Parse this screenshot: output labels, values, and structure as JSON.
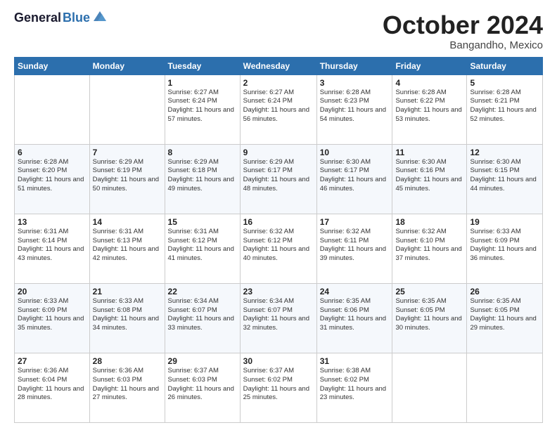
{
  "header": {
    "logo_general": "General",
    "logo_blue": "Blue",
    "month": "October 2024",
    "location": "Bangandho, Mexico"
  },
  "weekdays": [
    "Sunday",
    "Monday",
    "Tuesday",
    "Wednesday",
    "Thursday",
    "Friday",
    "Saturday"
  ],
  "weeks": [
    [
      {
        "day": "",
        "info": ""
      },
      {
        "day": "",
        "info": ""
      },
      {
        "day": "1",
        "info": "Sunrise: 6:27 AM\nSunset: 6:24 PM\nDaylight: 11 hours and 57 minutes."
      },
      {
        "day": "2",
        "info": "Sunrise: 6:27 AM\nSunset: 6:24 PM\nDaylight: 11 hours and 56 minutes."
      },
      {
        "day": "3",
        "info": "Sunrise: 6:28 AM\nSunset: 6:23 PM\nDaylight: 11 hours and 54 minutes."
      },
      {
        "day": "4",
        "info": "Sunrise: 6:28 AM\nSunset: 6:22 PM\nDaylight: 11 hours and 53 minutes."
      },
      {
        "day": "5",
        "info": "Sunrise: 6:28 AM\nSunset: 6:21 PM\nDaylight: 11 hours and 52 minutes."
      }
    ],
    [
      {
        "day": "6",
        "info": "Sunrise: 6:28 AM\nSunset: 6:20 PM\nDaylight: 11 hours and 51 minutes."
      },
      {
        "day": "7",
        "info": "Sunrise: 6:29 AM\nSunset: 6:19 PM\nDaylight: 11 hours and 50 minutes."
      },
      {
        "day": "8",
        "info": "Sunrise: 6:29 AM\nSunset: 6:18 PM\nDaylight: 11 hours and 49 minutes."
      },
      {
        "day": "9",
        "info": "Sunrise: 6:29 AM\nSunset: 6:17 PM\nDaylight: 11 hours and 48 minutes."
      },
      {
        "day": "10",
        "info": "Sunrise: 6:30 AM\nSunset: 6:17 PM\nDaylight: 11 hours and 46 minutes."
      },
      {
        "day": "11",
        "info": "Sunrise: 6:30 AM\nSunset: 6:16 PM\nDaylight: 11 hours and 45 minutes."
      },
      {
        "day": "12",
        "info": "Sunrise: 6:30 AM\nSunset: 6:15 PM\nDaylight: 11 hours and 44 minutes."
      }
    ],
    [
      {
        "day": "13",
        "info": "Sunrise: 6:31 AM\nSunset: 6:14 PM\nDaylight: 11 hours and 43 minutes."
      },
      {
        "day": "14",
        "info": "Sunrise: 6:31 AM\nSunset: 6:13 PM\nDaylight: 11 hours and 42 minutes."
      },
      {
        "day": "15",
        "info": "Sunrise: 6:31 AM\nSunset: 6:12 PM\nDaylight: 11 hours and 41 minutes."
      },
      {
        "day": "16",
        "info": "Sunrise: 6:32 AM\nSunset: 6:12 PM\nDaylight: 11 hours and 40 minutes."
      },
      {
        "day": "17",
        "info": "Sunrise: 6:32 AM\nSunset: 6:11 PM\nDaylight: 11 hours and 39 minutes."
      },
      {
        "day": "18",
        "info": "Sunrise: 6:32 AM\nSunset: 6:10 PM\nDaylight: 11 hours and 37 minutes."
      },
      {
        "day": "19",
        "info": "Sunrise: 6:33 AM\nSunset: 6:09 PM\nDaylight: 11 hours and 36 minutes."
      }
    ],
    [
      {
        "day": "20",
        "info": "Sunrise: 6:33 AM\nSunset: 6:09 PM\nDaylight: 11 hours and 35 minutes."
      },
      {
        "day": "21",
        "info": "Sunrise: 6:33 AM\nSunset: 6:08 PM\nDaylight: 11 hours and 34 minutes."
      },
      {
        "day": "22",
        "info": "Sunrise: 6:34 AM\nSunset: 6:07 PM\nDaylight: 11 hours and 33 minutes."
      },
      {
        "day": "23",
        "info": "Sunrise: 6:34 AM\nSunset: 6:07 PM\nDaylight: 11 hours and 32 minutes."
      },
      {
        "day": "24",
        "info": "Sunrise: 6:35 AM\nSunset: 6:06 PM\nDaylight: 11 hours and 31 minutes."
      },
      {
        "day": "25",
        "info": "Sunrise: 6:35 AM\nSunset: 6:05 PM\nDaylight: 11 hours and 30 minutes."
      },
      {
        "day": "26",
        "info": "Sunrise: 6:35 AM\nSunset: 6:05 PM\nDaylight: 11 hours and 29 minutes."
      }
    ],
    [
      {
        "day": "27",
        "info": "Sunrise: 6:36 AM\nSunset: 6:04 PM\nDaylight: 11 hours and 28 minutes."
      },
      {
        "day": "28",
        "info": "Sunrise: 6:36 AM\nSunset: 6:03 PM\nDaylight: 11 hours and 27 minutes."
      },
      {
        "day": "29",
        "info": "Sunrise: 6:37 AM\nSunset: 6:03 PM\nDaylight: 11 hours and 26 minutes."
      },
      {
        "day": "30",
        "info": "Sunrise: 6:37 AM\nSunset: 6:02 PM\nDaylight: 11 hours and 25 minutes."
      },
      {
        "day": "31",
        "info": "Sunrise: 6:38 AM\nSunset: 6:02 PM\nDaylight: 11 hours and 23 minutes."
      },
      {
        "day": "",
        "info": ""
      },
      {
        "day": "",
        "info": ""
      }
    ]
  ]
}
